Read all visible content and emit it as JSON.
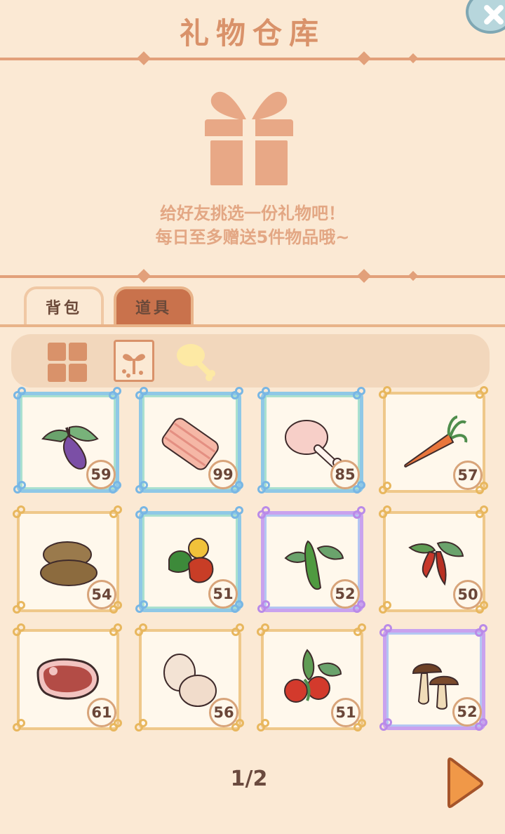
{
  "window": {
    "title": "礼物仓库"
  },
  "gift_panel": {
    "line1": "给好友挑选一份礼物吧！",
    "line2": "每日至多赠送5件物品哦~"
  },
  "tabs": [
    {
      "label": "背包",
      "active": true
    },
    {
      "label": "道具",
      "active": false
    }
  ],
  "filters": [
    {
      "icon": "grid-icon",
      "label": "all"
    },
    {
      "icon": "sprout-icon",
      "label": "seeds"
    },
    {
      "icon": "drumstick-icon",
      "label": "food"
    }
  ],
  "items": [
    {
      "icon": "eggplant-icon",
      "count": "59",
      "rarity": "blue"
    },
    {
      "icon": "ribs-icon",
      "count": "99",
      "rarity": "blue"
    },
    {
      "icon": "drumstick-icon",
      "count": "85",
      "rarity": "blue"
    },
    {
      "icon": "carrot-icon",
      "count": "57",
      "rarity": "gold"
    },
    {
      "icon": "potato-icon",
      "count": "54",
      "rarity": "gold"
    },
    {
      "icon": "pepper-icon",
      "count": "51",
      "rarity": "blue"
    },
    {
      "icon": "cucumber-icon",
      "count": "52",
      "rarity": "purple"
    },
    {
      "icon": "chili-icon",
      "count": "50",
      "rarity": "gold"
    },
    {
      "icon": "steak-icon",
      "count": "61",
      "rarity": "gold"
    },
    {
      "icon": "egg-icon",
      "count": "56",
      "rarity": "gold"
    },
    {
      "icon": "tomato-icon",
      "count": "51",
      "rarity": "gold"
    },
    {
      "icon": "mushroom-icon",
      "count": "52",
      "rarity": "purple"
    }
  ],
  "pager": {
    "text": "1/2"
  },
  "colors": {
    "background": "#fbe9d4",
    "accent": "#d9926a",
    "tab_inactive": "#c9724c"
  }
}
